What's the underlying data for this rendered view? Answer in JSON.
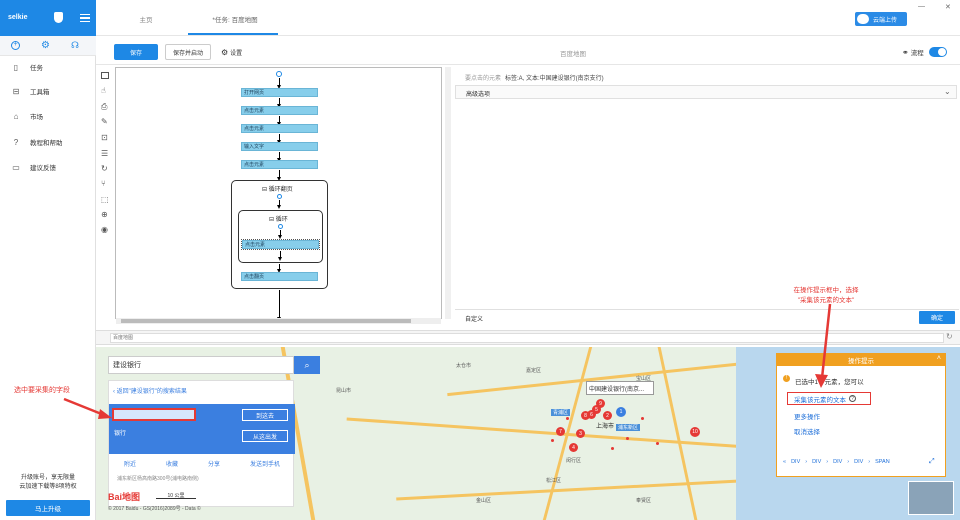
{
  "sidebar": {
    "brand": "selkie",
    "items": [
      {
        "label": "任务"
      },
      {
        "label": "工具箱"
      },
      {
        "label": "市场"
      },
      {
        "label": "教程和帮助"
      },
      {
        "label": "建议反馈"
      }
    ],
    "upgrade_text_1": "升级账号，享无限量",
    "upgrade_text_2": "云加速下载等8项特权",
    "upgrade_button": "马上升级"
  },
  "tabs": [
    {
      "label": "主页"
    },
    {
      "label": "*任务: 百度地图"
    }
  ],
  "header": {
    "cloud_upload": "云端上传"
  },
  "toolbar": {
    "save": "保存",
    "save_and_start": "保存并启动",
    "settings": "设置",
    "title": "百度地图",
    "flow_label": "流程"
  },
  "flow": {
    "steps": [
      "打开网页",
      "点击元素",
      "点击元素",
      "输入文字",
      "点击元素"
    ],
    "loop_outer": "循环翻页",
    "loop_inner": "循环",
    "inner_step": "点击元素",
    "page_step": "点击翻页"
  },
  "right_panel": {
    "selected_label": "要点击的元素",
    "selected_value": "标签:A, 文本:中国建设银行(南京支行)",
    "advanced": "高级选项",
    "custom": "自定义",
    "confirm": "确定"
  },
  "browser": {
    "url_placeholder": "百度地图"
  },
  "map": {
    "search_value": "建设银行",
    "back_link": "返回\"建设银行\"的搜索结果",
    "result_bank": "银行",
    "go_here": "到这去",
    "from_here": "从这出发",
    "action_links": [
      "附近",
      "收藏",
      "分享",
      "发送到手机"
    ],
    "address": "浦东新区杨高南路300号(浦电路南侧)",
    "popup_title": "中国建设银行(南京...",
    "scale": "10 公里",
    "copyright": "© 2017 Baidu - GS(2016)2089号 - Data ©",
    "pin_labels": [
      "1",
      "2",
      "3",
      "4",
      "5",
      "6",
      "7",
      "8",
      "9",
      "10"
    ],
    "places": [
      "嘉定区",
      "宝山区",
      "青浦区",
      "闵行区",
      "上海市",
      "浦东新区",
      "松江区",
      "奉贤区",
      "昆山市",
      "太仓市",
      "金山区"
    ],
    "baidu_logo": "Bai地图"
  },
  "tips": {
    "title": "操作提示",
    "selected_line": "已选中1个元素，您可以",
    "collect_text": "采集该元素的文本",
    "more_ops": "更多操作",
    "cancel_select": "取消选择",
    "path": [
      "DIV",
      "DIV",
      "DIV",
      "DIV",
      "SPAN"
    ]
  },
  "annotations": {
    "left_note": "选中要采集的字段",
    "right_note_1": "在操作提示框中，选择",
    "right_note_2": "\"采集该元素的文本\""
  },
  "colors": {
    "accent": "#1e88e5",
    "step": "#87ceeb",
    "annot": "#e53935"
  }
}
